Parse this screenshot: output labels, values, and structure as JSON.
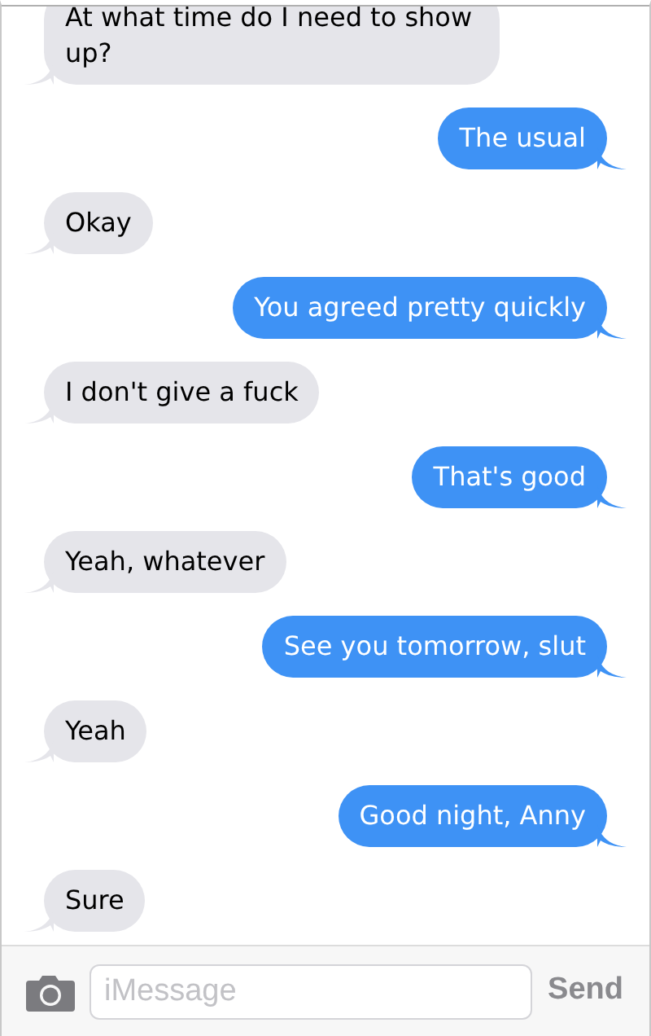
{
  "messages": [
    {
      "kind": "received",
      "text": "At what time do I need to show up?"
    },
    {
      "kind": "sent",
      "text": "The usual"
    },
    {
      "kind": "received",
      "text": "Okay"
    },
    {
      "kind": "sent",
      "text": "You agreed pretty quickly"
    },
    {
      "kind": "received",
      "text": "I don't give a fuck"
    },
    {
      "kind": "sent",
      "text": "That's good"
    },
    {
      "kind": "received",
      "text": "Yeah, whatever"
    },
    {
      "kind": "sent",
      "text": "See you tomorrow, slut"
    },
    {
      "kind": "received",
      "text": "Yeah"
    },
    {
      "kind": "sent",
      "text": "Good night, Anny"
    },
    {
      "kind": "received",
      "text": "Sure"
    }
  ],
  "composer": {
    "placeholder": "iMessage",
    "send": "Send"
  }
}
